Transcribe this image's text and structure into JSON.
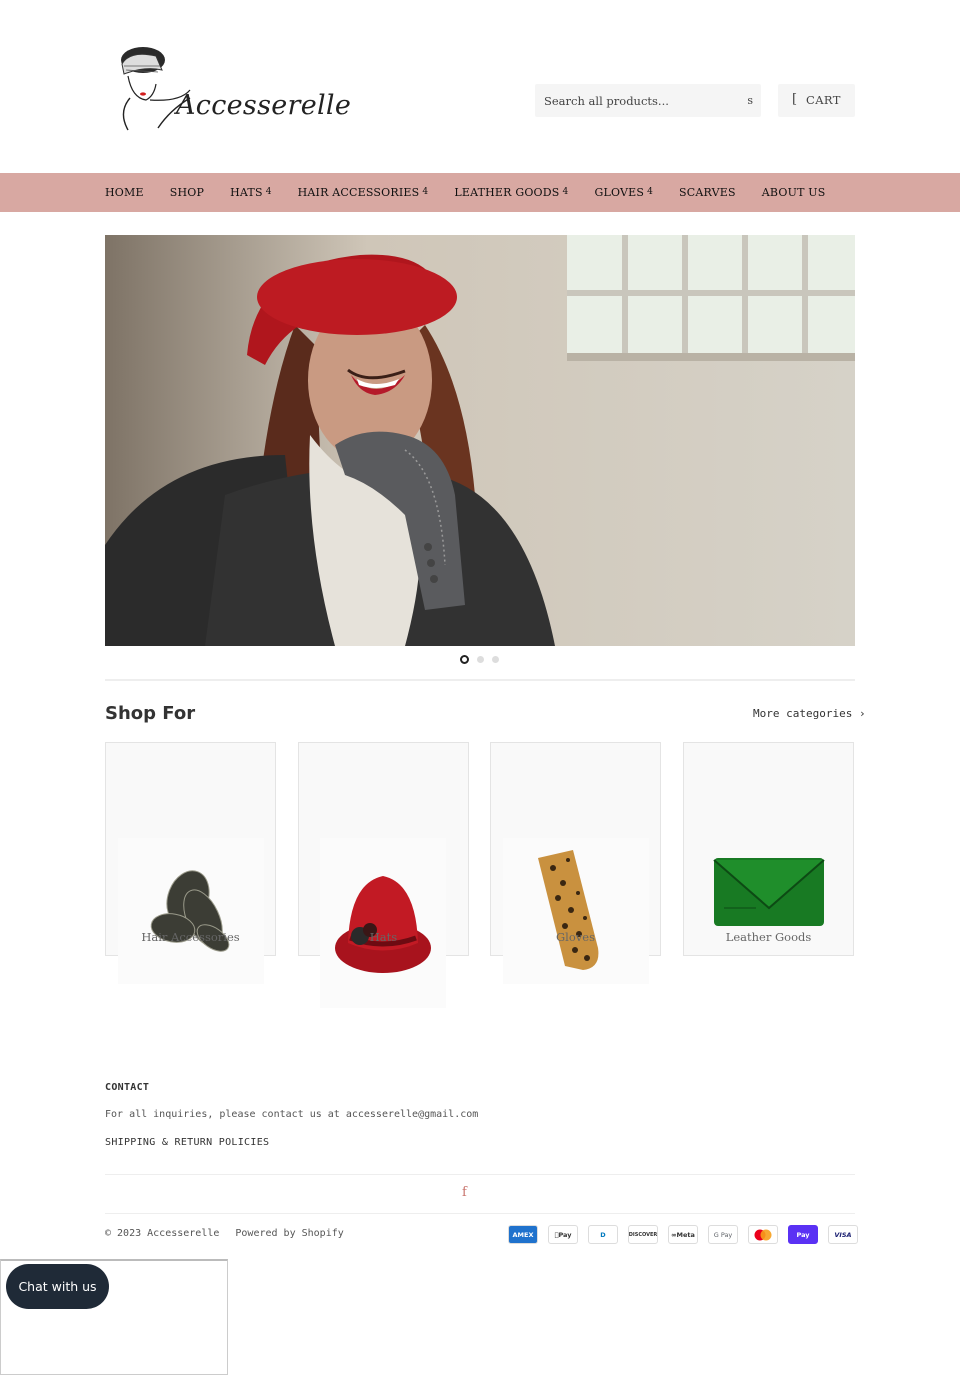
{
  "brand": {
    "name": "Accesserelle"
  },
  "header": {
    "search_placeholder": "Search all products...",
    "search_button": "s",
    "cart_bracket": "[",
    "cart_label": "CART"
  },
  "nav": {
    "items": [
      {
        "label": "HOME",
        "caret": ""
      },
      {
        "label": "SHOP",
        "caret": ""
      },
      {
        "label": "HATS",
        "caret": "4"
      },
      {
        "label": "HAIR ACCESSORIES",
        "caret": "4"
      },
      {
        "label": "LEATHER GOODS",
        "caret": "4"
      },
      {
        "label": "GLOVES",
        "caret": "4"
      },
      {
        "label": "SCARVES",
        "caret": ""
      },
      {
        "label": "ABOUT US",
        "caret": ""
      }
    ]
  },
  "slideshow": {
    "active_index": 0,
    "count": 3
  },
  "shop_for": {
    "title": "Shop For",
    "more_link": "More categories ›",
    "tiles": [
      {
        "label": "Hair Accessories"
      },
      {
        "label": "Hats"
      },
      {
        "label": "Gloves"
      },
      {
        "label": "Leather Goods"
      }
    ]
  },
  "footer": {
    "contact_heading": "CONTACT",
    "contact_text": "For all inquiries, please contact us at accesserelle@gmail.com",
    "shipping_link": "SHIPPING & RETURN POLICIES",
    "social_icon": "f",
    "copyright": "© 2023 Accesserelle",
    "powered": "Powered by Shopify",
    "payments": [
      {
        "name": "AMEX",
        "bg": "#1f72cd",
        "fg": "#ffffff"
      },
      {
        "name": "Pay",
        "bg": "#ffffff",
        "fg": "#000000"
      },
      {
        "name": "D",
        "bg": "#ffffff",
        "fg": "#0079be"
      },
      {
        "name": "DISCOVER",
        "bg": "#ffffff",
        "fg": "#222222"
      },
      {
        "name": "Meta",
        "bg": "#ffffff",
        "fg": "#333333"
      },
      {
        "name": "G Pay",
        "bg": "#ffffff",
        "fg": "#5f6368"
      },
      {
        "name": "",
        "bg": "#ffffff",
        "fg": "#000000"
      },
      {
        "name": "Pay",
        "bg": "#5a31f4",
        "fg": "#ffffff"
      },
      {
        "name": "VISA",
        "bg": "#ffffff",
        "fg": "#1a1f71"
      }
    ]
  },
  "chat": {
    "label": "Chat with us"
  }
}
